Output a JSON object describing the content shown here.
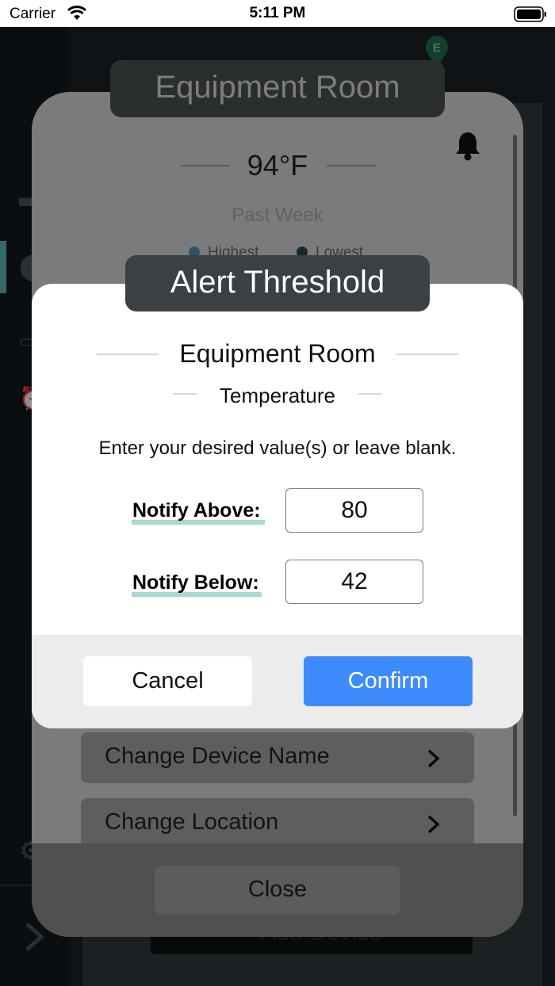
{
  "status_bar": {
    "carrier": "Carrier",
    "time": "5:11 PM"
  },
  "background": {
    "add_device_label": "+ Add Device",
    "pin_letter": "E",
    "sidebar_icons": [
      "list-icon",
      "map-pin-icon",
      "device-icon",
      "alarm-icon",
      "gear-icon",
      "chevron-right-icon"
    ]
  },
  "device_card": {
    "title": "Equipment Room",
    "temperature": "94°F",
    "period": "Past Week",
    "legend": [
      "Highest",
      "Lowest"
    ],
    "rows": [
      "Change Device Name",
      "Change Location"
    ],
    "close_label": "Close"
  },
  "alert_dialog": {
    "title": "Alert Threshold",
    "room": "Equipment Room",
    "metric": "Temperature",
    "instructions": "Enter your desired value(s) or leave blank.",
    "notify_above": {
      "label": "Notify Above:",
      "value": "80"
    },
    "notify_below": {
      "label": "Notify Below:",
      "value": "42"
    },
    "cancel_label": "Cancel",
    "confirm_label": "Confirm"
  },
  "colors": {
    "accent": "#3d8bfd",
    "underline": "#a9d9d3",
    "legend_highest": "#4f8fb6",
    "legend_lowest": "#1f4a55"
  }
}
